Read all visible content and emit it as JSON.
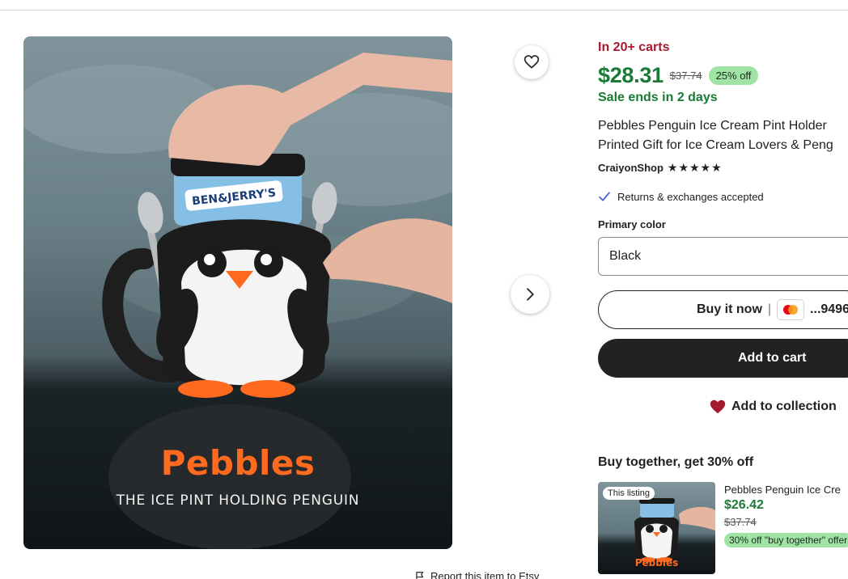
{
  "listing": {
    "social_proof": "In 20+ carts",
    "price": "$28.31",
    "original_price": "$37.74",
    "discount": "25% off",
    "sale_ends": "Sale ends in 2 days",
    "title_line1": "Pebbles Penguin Ice Cream Pint Holder",
    "title_line2": "Printed Gift for Ice Cream Lovers & Peng",
    "shop_name": "CraiyonShop",
    "rating_stars": "★★★★★",
    "returns": "Returns & exchanges accepted",
    "colors": {
      "accent_green": "#1b7a36",
      "cart_red": "#a61a2e",
      "badge_green": "#9fe3a5"
    }
  },
  "image": {
    "brand_title": "Pebbles",
    "brand_subtitle": "THE ICE PINT HOLDING PENGUIN",
    "pint_label": "BEN&JERRY'S"
  },
  "options": {
    "color_label": "Primary color",
    "color_value": "Black"
  },
  "actions": {
    "buy_now": "Buy it now",
    "buy_now_separator": "|",
    "card_last_digits": "...9496",
    "add_to_cart": "Add to cart",
    "add_to_collection": "Add to collection",
    "report": "Report this item to Etsy"
  },
  "bundle": {
    "heading": "Buy together, get 30% off",
    "badge": "This listing",
    "thumb_title": "Pebbles",
    "name": "Pebbles Penguin Ice Cre",
    "price": "$26.42",
    "original_price": "$37.74",
    "offer": "30% off \"buy together\" offer"
  },
  "icons": [
    "heart-icon",
    "chevron-right-icon",
    "check-icon",
    "mastercard-icon",
    "filled-heart-icon",
    "flag-icon",
    "star-icon"
  ]
}
